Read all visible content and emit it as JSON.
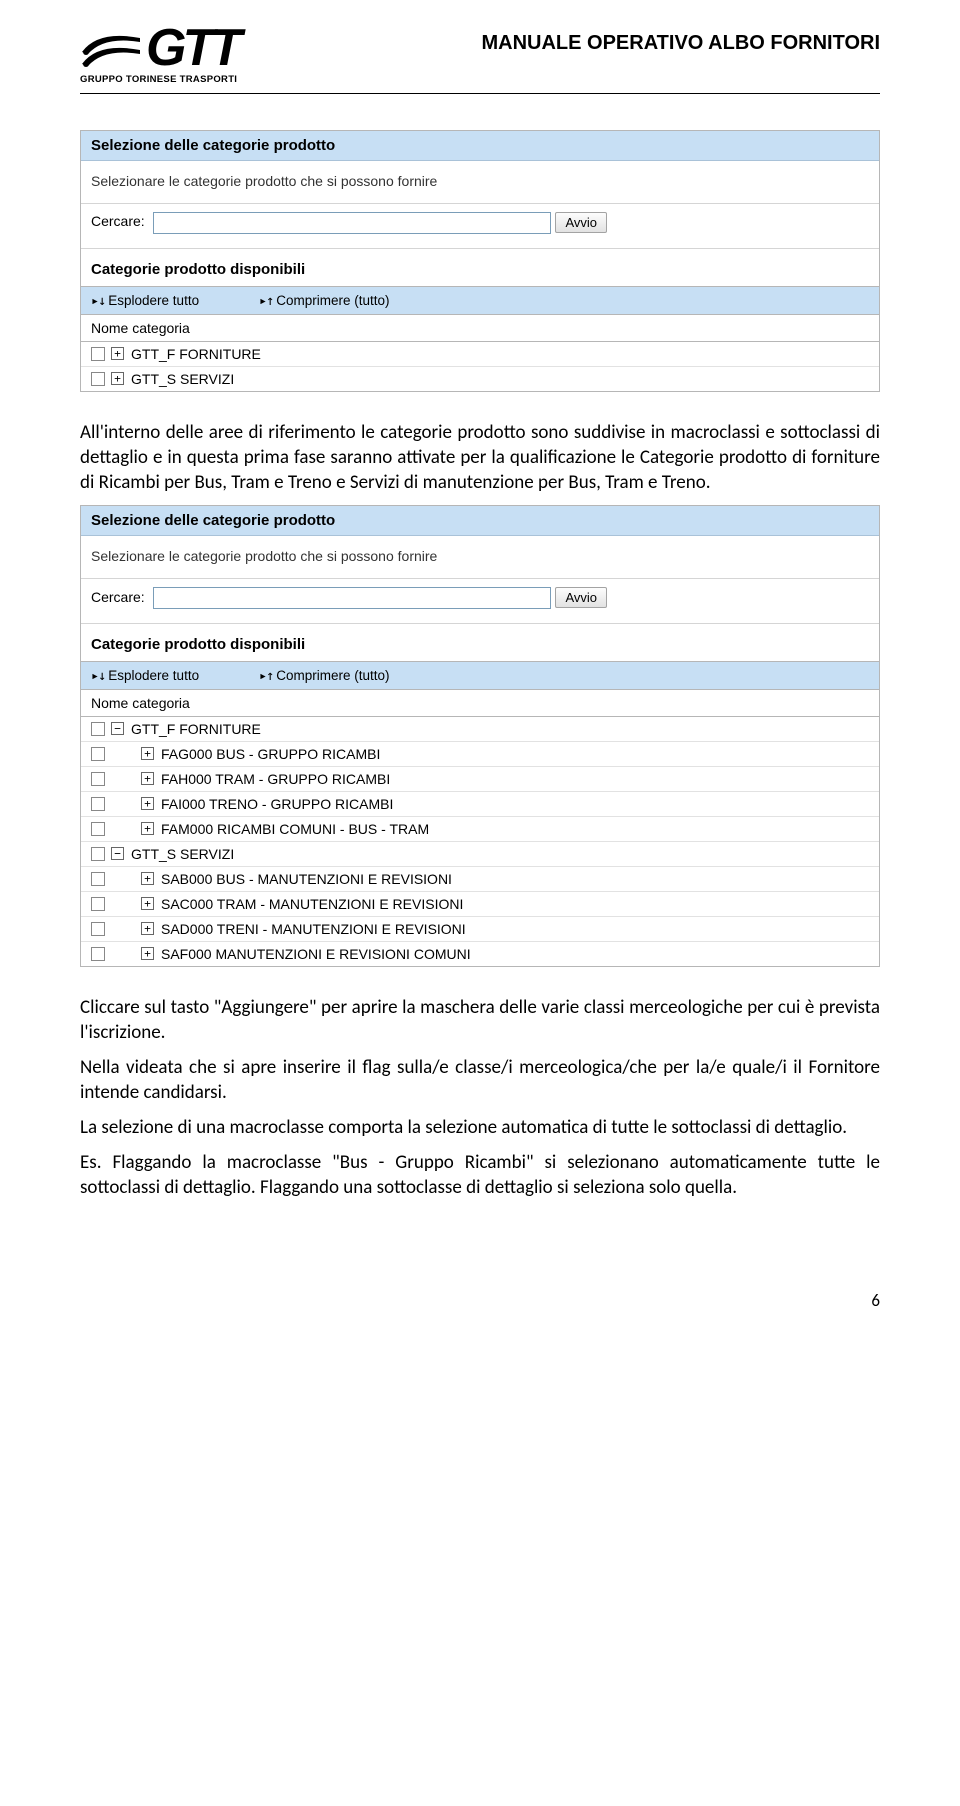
{
  "header": {
    "logo_text": "GTT",
    "logo_sub": "GRUPPO TORINESE TRASPORTI",
    "doc_title": "MANUALE OPERATIVO ALBO FORNITORI"
  },
  "panel": {
    "title": "Selezione delle categorie prodotto",
    "subtitle": "Selezionare le categorie prodotto che si possono fornire",
    "search_label": "Cercare:",
    "search_value": "",
    "search_button": "Avvio",
    "avail_title": "Categorie prodotto disponibili",
    "expand": "Esplodere tutto",
    "collapse": "Comprimere (tutto)",
    "col_name": "Nome categoria"
  },
  "tree1": [
    {
      "sign": "+",
      "label": "GTT_F FORNITURE"
    },
    {
      "sign": "+",
      "label": "GTT_S SERVIZI"
    }
  ],
  "para1": "All'interno delle aree di riferimento le categorie prodotto sono suddivise in macroclassi e sottoclassi di dettaglio e in questa prima fase saranno attivate per la qualificazione le Categorie prodotto di forniture di Ricambi per Bus, Tram e Treno e Servizi di manutenzione per Bus, Tram e Treno.",
  "tree2": [
    {
      "indent": 0,
      "sign": "−",
      "label": "GTT_F FORNITURE"
    },
    {
      "indent": 1,
      "sign": "+",
      "label": "FAG000 BUS - GRUPPO RICAMBI"
    },
    {
      "indent": 1,
      "sign": "+",
      "label": "FAH000 TRAM - GRUPPO RICAMBI"
    },
    {
      "indent": 1,
      "sign": "+",
      "label": "FAI000 TRENO - GRUPPO RICAMBI"
    },
    {
      "indent": 1,
      "sign": "+",
      "label": "FAM000 RICAMBI COMUNI - BUS - TRAM"
    },
    {
      "indent": 0,
      "sign": "−",
      "label": "GTT_S SERVIZI"
    },
    {
      "indent": 1,
      "sign": "+",
      "label": "SAB000 BUS - MANUTENZIONI E REVISIONI"
    },
    {
      "indent": 1,
      "sign": "+",
      "label": "SAC000 TRAM - MANUTENZIONI E REVISIONI"
    },
    {
      "indent": 1,
      "sign": "+",
      "label": "SAD000 TRENI - MANUTENZIONI E REVISIONI"
    },
    {
      "indent": 1,
      "sign": "+",
      "label": "SAF000 MANUTENZIONI E REVISIONI COMUNI"
    }
  ],
  "para2": "Cliccare sul tasto \"Aggiungere\" per aprire la maschera delle varie classi merceologiche per cui è prevista l'iscrizione.",
  "para3": "Nella videata che si apre inserire il flag sulla/e classe/i merceologica/che per la/e quale/i il Fornitore intende candidarsi.",
  "para4": "La selezione di una macroclasse comporta la selezione automatica di tutte le sottoclassi di dettaglio.",
  "para5": "Es. Flaggando la macroclasse \"Bus - Gruppo Ricambi\" si selezionano automaticamente tutte le sottoclassi di dettaglio. Flaggando una sottoclasse di dettaglio si seleziona solo quella.",
  "page_num": "6"
}
